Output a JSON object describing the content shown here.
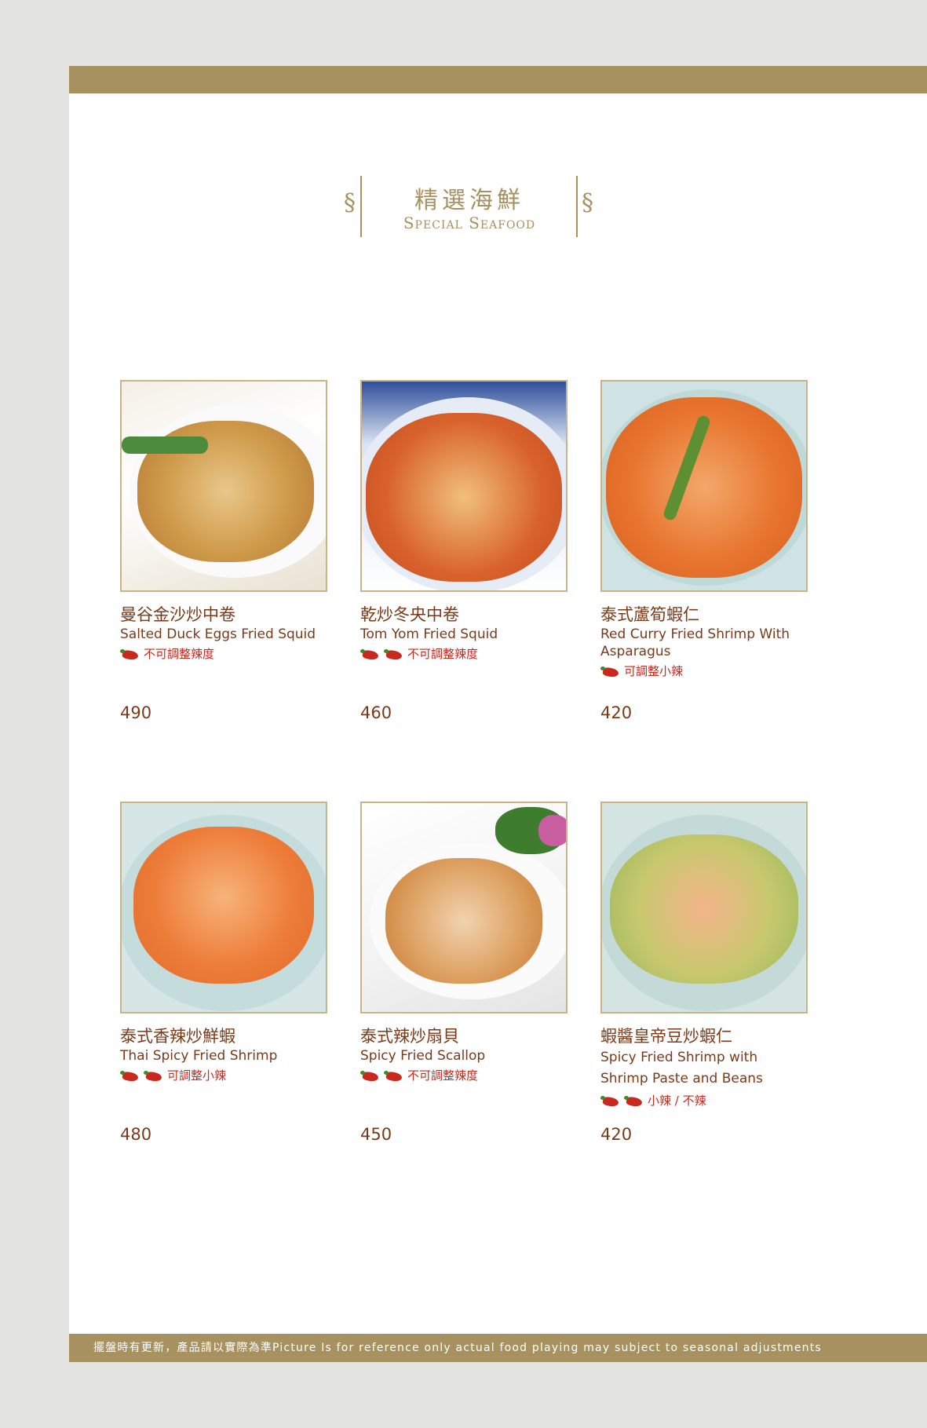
{
  "header": {
    "title_zh": "精選海鮮",
    "title_en": "Special Seafood"
  },
  "dishes": [
    {
      "name_zh": "曼谷金沙炒中卷",
      "name_en": "Salted Duck Eggs Fried Squid",
      "chili_count": 1,
      "spice_note": "不可調整辣度",
      "price": "490"
    },
    {
      "name_zh": "乾炒冬央中卷",
      "name_en": "Tom Yom Fried Squid",
      "chili_count": 2,
      "spice_note": "不可調整辣度",
      "price": "460"
    },
    {
      "name_zh": "泰式蘆筍蝦仁",
      "name_en": "Red Curry Fried Shrimp With Asparagus",
      "chili_count": 1,
      "spice_note": "可調整小辣",
      "price": "420"
    },
    {
      "name_zh": "泰式香辣炒鮮蝦",
      "name_en": "Thai Spicy Fried Shrimp",
      "chili_count": 2,
      "spice_note": "可調整小辣",
      "price": "480"
    },
    {
      "name_zh": "泰式辣炒扇貝",
      "name_en": "Spicy Fried Scallop",
      "chili_count": 2,
      "spice_note": "不可調整辣度",
      "price": "450"
    },
    {
      "name_zh": "蝦醬皇帝豆炒蝦仁",
      "name_en": "Spicy Fried  Shrimp with Shrimp Paste and Beans",
      "chili_count": 2,
      "spice_note": "小辣 / 不辣",
      "price": "420"
    }
  ],
  "footer": {
    "note": "擺盤時有更新，產品請以實際為準Picture Is for reference only actual food playing may subject to seasonal adjustments"
  },
  "colors": {
    "gold": "#a6915f",
    "text_brown": "#7a3a1a",
    "chili_red": "#c8281e"
  }
}
